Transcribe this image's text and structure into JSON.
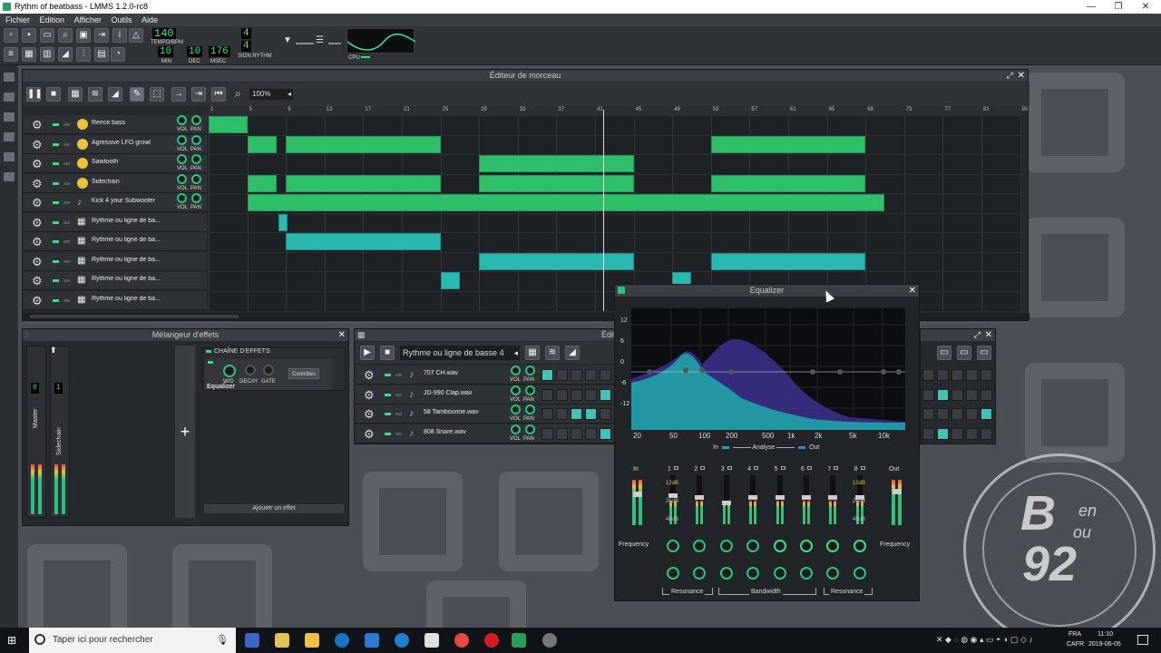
{
  "window": {
    "title": "Rythm of beatbass - LMMS 1.2.0-rc8",
    "minimize": "—",
    "maximize": "❐",
    "close": "✕"
  },
  "menu": [
    "Fichier",
    "Edition",
    "Afficher",
    "Outils",
    "Aide"
  ],
  "toolbar": {
    "tempo": "140",
    "tempo_label": "TEMPO/BPM",
    "time_min": "10",
    "time_dec": "10",
    "time_msec": "176",
    "min_label": "MIN",
    "dec_label": "DEC",
    "msec_label": "MSEC",
    "sig_top": "4",
    "sig_bottom": "4",
    "sig_label": "SIGN RYTHM",
    "cpu_label": "CPU"
  },
  "song_editor": {
    "title": "Éditeur de morceau",
    "zoom": "100%",
    "ruler": [
      "1",
      "5",
      "9",
      "13",
      "17",
      "21",
      "25",
      "29",
      "33",
      "37",
      "41",
      "45",
      "49",
      "53",
      "57",
      "61",
      "65",
      "69",
      "73",
      "77",
      "81",
      "85"
    ],
    "tracks": [
      {
        "name": "Reece bass",
        "type": "synth"
      },
      {
        "name": "Agressive LFO growl",
        "type": "synth"
      },
      {
        "name": "Sawtooth",
        "type": "synth"
      },
      {
        "name": "Sidechain",
        "type": "synth"
      },
      {
        "name": "Kick 4 your Subwoofer",
        "type": "sample"
      },
      {
        "name": "Rythme ou ligne de ba...",
        "type": "beat"
      },
      {
        "name": "Rythme ou ligne de ba...",
        "type": "beat"
      },
      {
        "name": "Rythme ou ligne de ba...",
        "type": "beat"
      },
      {
        "name": "Rythme ou ligne de ba...",
        "type": "beat"
      },
      {
        "name": "Rythme ou ligne de ba...",
        "type": "beat"
      }
    ],
    "vol_label": "VOL",
    "pan_label": "PAN"
  },
  "mixer": {
    "title": "Mélangeur d'effets",
    "channels": [
      "Master",
      "Sidechain"
    ],
    "chain_label": "CHAÎNE D'EFFETS",
    "effect_name": "Equalizer",
    "w_d": "W/D",
    "decay": "DECAY",
    "gate": "GATE",
    "controls_btn": "Contrôles",
    "add_effect": "Ajouter un effet",
    "master_value": "0"
  },
  "beat_editor": {
    "title": "Édit",
    "pattern": "Rythme ou ligne de basse 4",
    "samples": [
      "707 CH.wav",
      "JD-990 Clap.wav",
      "58 Tambourine.wav",
      "808 Snare.wav"
    ]
  },
  "equalizer": {
    "title": "Equalizer",
    "db_labels": [
      "12",
      "6",
      "0",
      "-6",
      "-12"
    ],
    "freq_labels": [
      "20",
      "50",
      "100",
      "200",
      "500",
      "1k",
      "2k",
      "5k",
      "10k"
    ],
    "in_label": "In",
    "out_label": "Out",
    "analyse_label": "Analyse",
    "bands": [
      "1",
      "2",
      "3",
      "4",
      "5",
      "6",
      "7",
      "8"
    ],
    "band_marks": [
      "12dB",
      "24dB",
      "48dB"
    ],
    "frequency": "Frequency",
    "resonance": "Resonance",
    "bandwidth": "Bandwidth"
  },
  "taskbar": {
    "search_placeholder": "Taper ici pour rechercher",
    "lang": "FRA",
    "lang2": "CAFR",
    "time": "11:10",
    "date": "2019-06-05"
  },
  "watermark": {
    "line1": "B",
    "line2": "en",
    "line3": "ou",
    "line4": "92"
  }
}
